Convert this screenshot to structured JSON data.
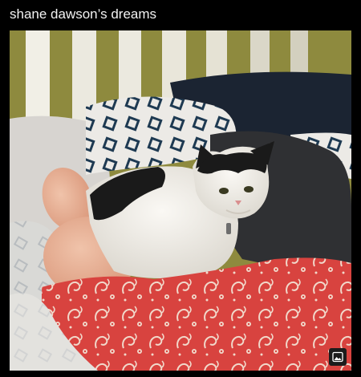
{
  "post": {
    "title": "shane dawson’s dreams"
  },
  "image": {
    "badge_icon": "image-icon"
  },
  "colors": {
    "background": "#000000",
    "title_text": "#f2f2f2",
    "wall": "#8e8a3e",
    "crib_slats": "#f1efe6",
    "pillow_navy": "#1b2432",
    "cushion_gray": "#2f3033",
    "cat_white": "#f3f1ec",
    "cat_black": "#1a1a1a",
    "blanket_red": "#d8433f",
    "blanket_cream": "#f1d9cb",
    "skin": "#e8b196"
  }
}
